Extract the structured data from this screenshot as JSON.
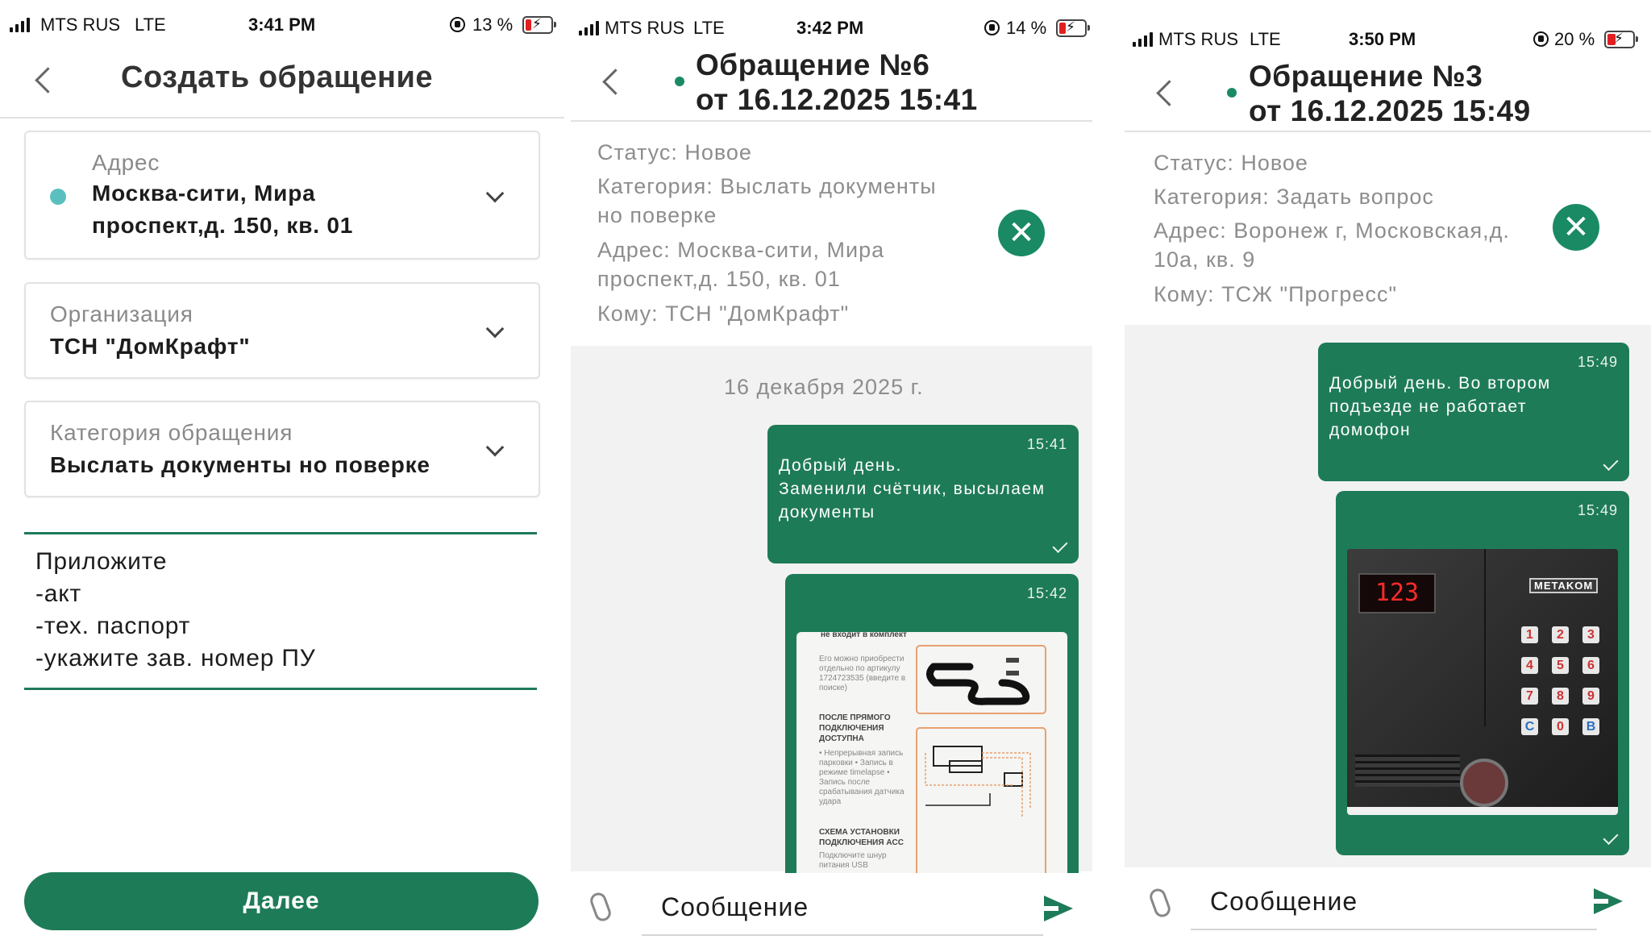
{
  "colors": {
    "accent": "#1e7b58",
    "status_dot": "#5bbfbf",
    "battery_low": "#e02020"
  },
  "screen1": {
    "status": {
      "carrier": "MTS RUS",
      "network": "LTE",
      "time": "3:41 PM",
      "battery": "13 %",
      "battery_level": 0.13
    },
    "title": "Создать обращение",
    "address": {
      "label": "Адрес",
      "line1": "Москва-сити, Мира",
      "line2": "проспект,д. 150, кв. 01"
    },
    "organization": {
      "label": "Организация",
      "value": "ТСН \"ДомКрафт\""
    },
    "category": {
      "label": "Категория обращения",
      "value": "Выслать документы но поверке"
    },
    "note": {
      "lines": [
        "Приложите",
        "-акт",
        "-тех. паспорт",
        "-укажите зав. номер ПУ"
      ]
    },
    "next_button": "Далее"
  },
  "screen2": {
    "status": {
      "carrier": "MTS RUS",
      "network": "LTE",
      "time": "3:42 PM",
      "battery": "14 %",
      "battery_level": 0.14
    },
    "title_line1": "Обращение №6",
    "title_line2": "от 16.12.2025 15:41",
    "info": {
      "status": "Статус: Новое",
      "category_line1": "Категория: Выслать документы",
      "category_line2": "но поверке",
      "address_line1": "Адрес: Москва-сити, Мира",
      "address_line2": "проспект,д. 150, кв. 01",
      "to": "Кому: ТСН \"ДомКрафт\""
    },
    "close_icon": "✕",
    "date_separator": "16 декабря 2025 г.",
    "messages": [
      {
        "time": "15:41",
        "lines": [
          "Добрый день.",
          "Заменили счётчик, высылаем",
          "документы"
        ]
      },
      {
        "time": "15:42",
        "attachment": "document-image"
      }
    ],
    "doc": {
      "t1": "не входит в комплект",
      "t2": "Его можно приобрести отдельно по артикулу 1724723535 (введите в поиске)",
      "h1": "ПОСЛЕ ПРЯМОГО ПОДКЛЮЧЕНИЯ ДОСТУПНА",
      "t3": "• Непрерывная запись парковки • Запись в режиме timelapse • Запись после срабатывания датчика удара",
      "h2": "СХЕМА УСТАНОВКИ ПОДКЛЮЧЕНИЯ ACC",
      "t4": "Подключите шнур питания USB"
    },
    "input_placeholder": "Сообщение"
  },
  "screen3": {
    "status": {
      "carrier": "MTS RUS",
      "network": "LTE",
      "time": "3:50 PM",
      "battery": "20 %",
      "battery_level": 0.2
    },
    "title_line1": "Обращение №3",
    "title_line2": "от 16.12.2025 15:49",
    "info": {
      "status": "Статус: Новое",
      "category": "Категория: Задать вопрос",
      "address_line1": "Адрес: Воронеж г, Московская,д.",
      "address_line2": "10а, кв. 9",
      "to": "Кому: ТСЖ \"Прогресс\""
    },
    "close_icon": "✕",
    "messages": [
      {
        "time": "15:49",
        "lines": [
          "Добрый день. Во втором",
          "подъезде не работает",
          "домофон"
        ]
      },
      {
        "time": "15:49",
        "attachment": "intercom-photo"
      }
    ],
    "intercom": {
      "display": "123",
      "brand": "METAKOM",
      "keys": [
        "1",
        "2",
        "3",
        "4",
        "5",
        "6",
        "7",
        "8",
        "9",
        "C",
        "0",
        "B"
      ]
    },
    "input_placeholder": "Сообщение"
  }
}
